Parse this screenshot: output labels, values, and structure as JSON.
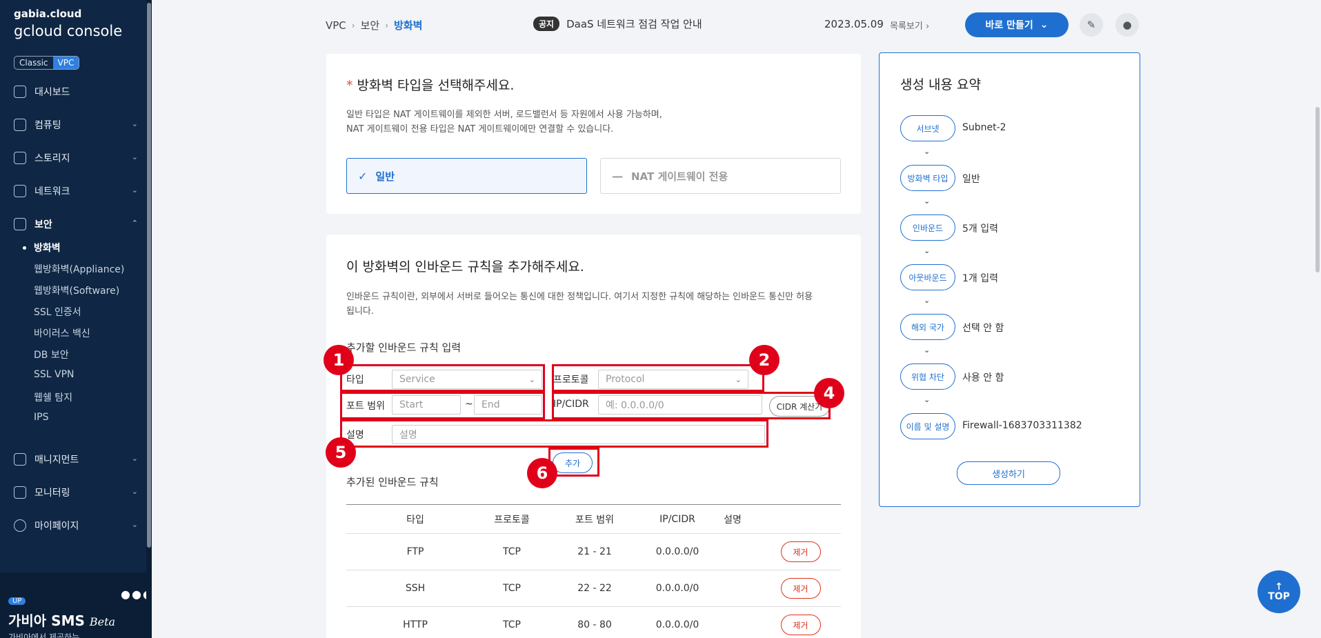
{
  "sidebar": {
    "brand_small": "gabia.cloud",
    "brand_big": "gcloud console",
    "toggle": {
      "classic": "Classic",
      "vpc": "VPC"
    },
    "nav": [
      {
        "label": "대시보드",
        "icon": "dashboard-icon"
      },
      {
        "label": "컴퓨팅",
        "icon": "chip-icon"
      },
      {
        "label": "스토리지",
        "icon": "storage-icon"
      },
      {
        "label": "네트워크",
        "icon": "network-icon"
      },
      {
        "label": "보안",
        "icon": "shield-icon"
      },
      {
        "label": "매니지먼트",
        "icon": "management-icon"
      },
      {
        "label": "모니터링",
        "icon": "monitoring-icon"
      },
      {
        "label": "마이페이지",
        "icon": "user-icon"
      }
    ],
    "security_sub": [
      "방화벽",
      "웹방화벽(Appliance)",
      "웹방화벽(Software)",
      "SSL 인증서",
      "바이러스 백신",
      "DB 보안",
      "SSL VPN",
      "웹쉘 탐지",
      "IPS"
    ],
    "sms": {
      "badge": "UP",
      "title": "가비아 SMS",
      "beta": "Beta",
      "subtitle": "가비아에서 제공하는"
    }
  },
  "topbar": {
    "breadcrumb": [
      "VPC",
      "보안",
      "방화벽"
    ],
    "notice_tag": "공지",
    "notice_text": "DaaS 네트워크 점검 작업 안내",
    "notice_date": "2023.05.09",
    "notice_list": "목록보기",
    "make_button": "바로 만들기"
  },
  "type_section": {
    "title": "방화벽 타입을 선택해주세요.",
    "desc_line1": "일반 타입은 NAT 게이트웨이를 제외한 서버, 로드밸런서 등 자원에서 사용 가능하며,",
    "desc_line2": "NAT 게이트웨이 전용 타입은 NAT 게이트웨이에만 연결할 수 있습니다.",
    "option_general": "일반",
    "option_nat": "NAT 게이트웨이 전용"
  },
  "inbound": {
    "title": "이 방화벽의 인바운드 규칙을 추가해주세요.",
    "desc_line1": "인바운드 규칙이란, 외부에서 서버로 들어오는 통신에 대한 정책입니다. 여기서 지정한 규칙에 해당하는 인바운드 통신만 허용",
    "desc_line2": "됩니다.",
    "add_title": "추가할 인바운드 규칙 입력",
    "type_label": "타입",
    "type_placeholder": "Service",
    "protocol_label": "프로토콜",
    "protocol_placeholder": "Protocol",
    "port_label": "포트 범위",
    "port_start": "Start",
    "port_tilde": "~",
    "port_end": "End",
    "ip_label": "IP/CIDR",
    "ip_placeholder": "예: 0.0.0.0/0",
    "cidr_button": "CIDR 계산기",
    "desc_label": "설명",
    "desc_placeholder": "설명",
    "add_button": "추가",
    "added_title": "추가된 인바운드 규칙",
    "columns": [
      "타입",
      "프로토콜",
      "포트 범위",
      "IP/CIDR",
      "설명",
      ""
    ],
    "rows": [
      {
        "type": "FTP",
        "protocol": "TCP",
        "port": "21 - 21",
        "ip": "0.0.0.0/0",
        "desc": "",
        "action": "제거"
      },
      {
        "type": "SSH",
        "protocol": "TCP",
        "port": "22 - 22",
        "ip": "0.0.0.0/0",
        "desc": "",
        "action": "제거"
      },
      {
        "type": "HTTP",
        "protocol": "TCP",
        "port": "80 - 80",
        "ip": "0.0.0.0/0",
        "desc": "",
        "action": "제거"
      }
    ]
  },
  "annotations": [
    "1",
    "2",
    "4",
    "5",
    "6"
  ],
  "summary": {
    "title": "생성 내용 요약",
    "items": [
      {
        "label": "서브넷",
        "value": "Subnet-2"
      },
      {
        "label": "방화벽 타입",
        "value": "일반"
      },
      {
        "label": "인바운드",
        "value": "5개 입력"
      },
      {
        "label": "아웃바운드",
        "value": "1개 입력"
      },
      {
        "label": "해외 국가",
        "value": "선택 안 함"
      },
      {
        "label": "위협 차단",
        "value": "사용 안 함"
      },
      {
        "label": "이름 및 설명",
        "value": "Firewall-1683703311382"
      }
    ],
    "create_button": "생성하기"
  },
  "top_button": "TOP",
  "colors": {
    "accent": "#1f6fd0",
    "sidebar": "#0f2744",
    "annotation": "#e0001a"
  }
}
